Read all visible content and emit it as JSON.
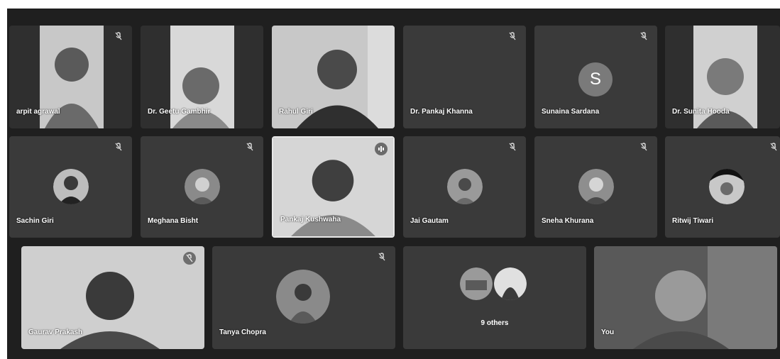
{
  "tiles": [
    {
      "name": "arpit agrawal"
    },
    {
      "name": "Dr. Geetu Gambhir"
    },
    {
      "name": "Rahul Giri"
    },
    {
      "name": "Dr. Pankaj Khanna"
    },
    {
      "name": "Sunaina Sardana",
      "initial": "S"
    },
    {
      "name": "Dr. Sunita Hooda"
    },
    {
      "name": "Sachin Giri"
    },
    {
      "name": "Meghana Bisht"
    },
    {
      "name": "Pankaj Kushwaha"
    },
    {
      "name": "Jai Gautam"
    },
    {
      "name": "Sneha Khurana"
    },
    {
      "name": "Ritwij Tiwari"
    },
    {
      "name": "Gaurav Prakash"
    },
    {
      "name": "Tanya Chopra"
    },
    {
      "label": "9 others"
    },
    {
      "name": "You"
    }
  ],
  "icons": {
    "muted": "mic-off-icon",
    "speaking": "audio-level-icon"
  },
  "colors": {
    "stage": "#1f1f1f",
    "tile": "#3a3a3a",
    "avatar_letter": "#7a7a7a"
  }
}
